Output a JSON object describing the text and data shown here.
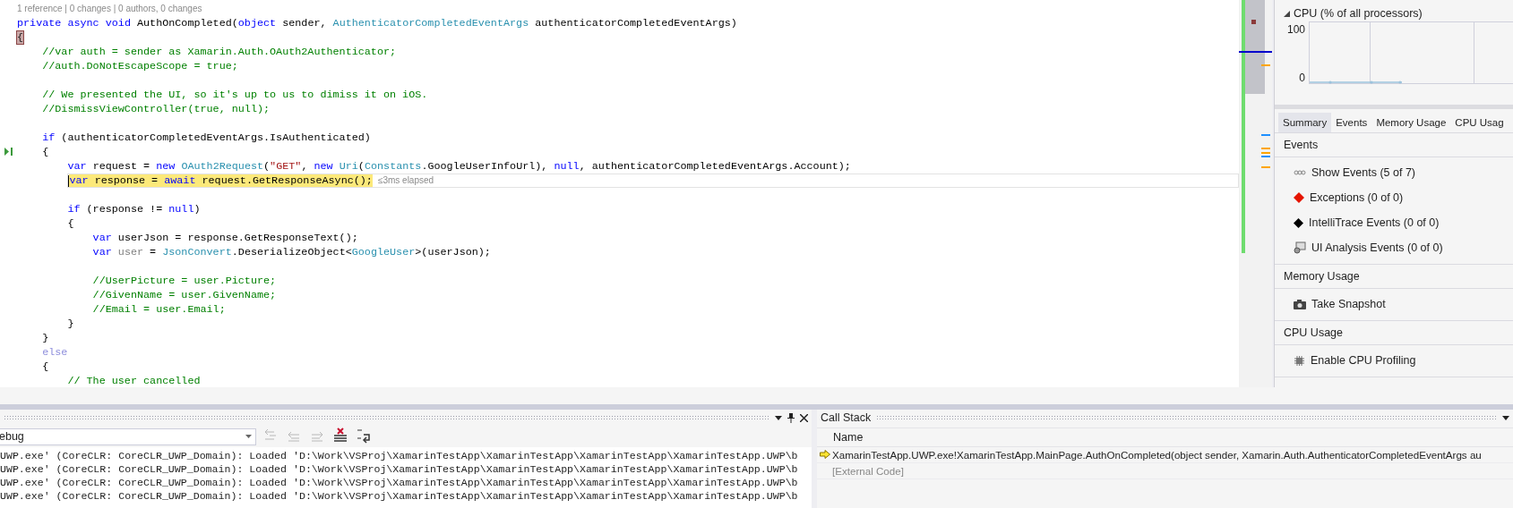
{
  "editor": {
    "code_lens": "1 reference | 0 changes | 0 authors, 0 changes",
    "lines": [
      {
        "current": false,
        "segments": [
          {
            "kind": "keyword",
            "text": "private"
          },
          {
            "kind": "keyword",
            "text": " async"
          },
          {
            "kind": "keyword",
            "text": " void"
          },
          {
            "kind": "plain",
            "text": " AuthOnCompleted("
          },
          {
            "kind": "keyword",
            "text": "object"
          },
          {
            "kind": "plain",
            "text": " sender, "
          },
          {
            "kind": "type",
            "text": "AuthenticatorCompletedEventArgs"
          },
          {
            "kind": "plain",
            "text": " authenticatorCompletedEventArgs)"
          }
        ]
      },
      {
        "current": false,
        "segments": [
          {
            "kind": "brace_match",
            "text": "{"
          }
        ]
      },
      {
        "current": false,
        "segments": [
          {
            "kind": "comment",
            "text": "    //var auth = sender as Xamarin.Auth.OAuth2Authenticator;"
          }
        ]
      },
      {
        "current": false,
        "segments": [
          {
            "kind": "comment",
            "text": "    //auth.DoNotEscapeScope = true;"
          }
        ]
      },
      {
        "current": false
      },
      {
        "current": false,
        "segments": [
          {
            "kind": "comment",
            "text": "    // We presented the UI, so it's up to us to dimiss it on iOS."
          }
        ]
      },
      {
        "current": false,
        "segments": [
          {
            "kind": "comment",
            "text": "    //DismissViewController(true, null);"
          }
        ]
      },
      {
        "current": false
      },
      {
        "current": false,
        "segments": [
          {
            "kind": "keyword",
            "text": "    if"
          },
          {
            "kind": "plain",
            "text": " (authenticatorCompletedEventArgs.IsAuthenticated)"
          }
        ]
      },
      {
        "current": false,
        "kind": "run-to-click",
        "segments": [
          {
            "kind": "plain",
            "text": "    {"
          }
        ]
      },
      {
        "current": false,
        "segments": [
          {
            "kind": "keyword",
            "text": "        var"
          },
          {
            "kind": "plain",
            "text": " request = "
          },
          {
            "kind": "keyword",
            "text": "new "
          },
          {
            "kind": "type",
            "text": "OAuth2Request"
          },
          {
            "kind": "plain",
            "text": "("
          },
          {
            "kind": "string",
            "text": "\"GET\""
          },
          {
            "kind": "plain",
            "text": ", "
          },
          {
            "kind": "keyword",
            "text": "new "
          },
          {
            "kind": "type",
            "text": "Uri"
          },
          {
            "kind": "plain",
            "text": "("
          },
          {
            "kind": "type",
            "text": "Constants"
          },
          {
            "kind": "plain",
            "text": ".GoogleUserInfoUrl), "
          },
          {
            "kind": "keyword",
            "text": "null"
          },
          {
            "kind": "plain",
            "text": ", authenticatorCompletedEventArgs.Account);"
          }
        ]
      },
      {
        "current": true,
        "segments": [
          {
            "kind": "keyword",
            "text": "        var"
          },
          {
            "kind": "plain",
            "text": " response = "
          },
          {
            "kind": "keyword",
            "text": "await"
          },
          {
            "kind": "plain",
            "text": " request.GetResponseAsync();"
          }
        ],
        "perf_tip": "≤3ms elapsed"
      },
      {
        "current": false
      },
      {
        "current": false,
        "segments": [
          {
            "kind": "keyword",
            "text": "        if"
          },
          {
            "kind": "plain",
            "text": " (response != "
          },
          {
            "kind": "keyword",
            "text": "null"
          },
          {
            "kind": "plain",
            "text": ")"
          }
        ]
      },
      {
        "current": false,
        "segments": [
          {
            "kind": "plain",
            "text": "        {"
          }
        ]
      },
      {
        "current": false,
        "segments": [
          {
            "kind": "keyword",
            "text": "            var"
          },
          {
            "kind": "plain",
            "text": " userJson = response.GetResponseText();"
          }
        ]
      },
      {
        "current": false,
        "segments": [
          {
            "kind": "keyword",
            "text": "            var"
          },
          {
            "kind": "unused",
            "text": " user"
          },
          {
            "kind": "plain",
            "text": " = "
          },
          {
            "kind": "type",
            "text": "JsonConvert"
          },
          {
            "kind": "plain",
            "text": ".DeserializeObject<"
          },
          {
            "kind": "type",
            "text": "GoogleUser"
          },
          {
            "kind": "plain",
            "text": ">(userJson);"
          }
        ]
      },
      {
        "current": false
      },
      {
        "current": false,
        "segments": [
          {
            "kind": "comment",
            "text": "            //UserPicture = user.Picture;"
          }
        ]
      },
      {
        "current": false,
        "segments": [
          {
            "kind": "comment",
            "text": "            //GivenName = user.GivenName;"
          }
        ]
      },
      {
        "current": false,
        "segments": [
          {
            "kind": "comment",
            "text": "            //Email = user.Email;"
          }
        ]
      },
      {
        "current": false,
        "segments": [
          {
            "kind": "plain",
            "text": "        }"
          }
        ]
      },
      {
        "current": false,
        "segments": [
          {
            "kind": "plain",
            "text": "    }"
          }
        ]
      },
      {
        "current": false,
        "segments": [
          {
            "kind": "inactive",
            "text": "    else"
          }
        ]
      },
      {
        "current": false,
        "segments": [
          {
            "kind": "plain",
            "text": "    {"
          }
        ]
      },
      {
        "current": false,
        "segments": [
          {
            "kind": "comment",
            "text": "        // The user cancelled"
          }
        ]
      }
    ]
  },
  "diagnostics": {
    "graph_title": "CPU (% of all processors)",
    "graph_axis_labels": [
      "100",
      "0"
    ],
    "tabs": [
      {
        "label": "Summary",
        "selected": true
      },
      {
        "label": "Events",
        "selected": false
      },
      {
        "label": "Memory Usage",
        "selected": false
      },
      {
        "label": "CPU Usag",
        "selected": false
      }
    ],
    "sections": [
      {
        "title": "Events",
        "items": [
          {
            "kind": "events",
            "label": "Show Events (5 of 7)"
          },
          {
            "kind": "exceptions",
            "label": "Exceptions (0 of 0)"
          },
          {
            "kind": "intellitrace",
            "label": "IntelliTrace Events (0 of 0)"
          },
          {
            "kind": "ui-analysis",
            "label": "UI Analysis Events (0 of 0)"
          }
        ]
      },
      {
        "title": "Memory Usage",
        "items": [
          {
            "kind": "snapshot",
            "label": "Take Snapshot"
          }
        ]
      },
      {
        "title": "CPU Usage",
        "items": [
          {
            "kind": "cpu",
            "label": "Enable CPU Profiling"
          }
        ]
      }
    ]
  },
  "output": {
    "source": "ebug",
    "toolbar": [
      {
        "kind": "find-source",
        "disabled": true
      },
      {
        "kind": "previous",
        "disabled": true
      },
      {
        "kind": "next",
        "disabled": true
      },
      {
        "kind": "clear-all",
        "disabled": false
      },
      {
        "kind": "word-wrap",
        "disabled": false
      }
    ],
    "lines": [
      "UWP.exe' (CoreCLR: CoreCLR_UWP_Domain): Loaded 'D:\\Work\\VSProj\\XamarinTestApp\\XamarinTestApp\\XamarinTestApp\\XamarinTestApp.UWP\\b",
      "UWP.exe' (CoreCLR: CoreCLR_UWP_Domain): Loaded 'D:\\Work\\VSProj\\XamarinTestApp\\XamarinTestApp\\XamarinTestApp\\XamarinTestApp.UWP\\b",
      "UWP.exe' (CoreCLR: CoreCLR_UWP_Domain): Loaded 'D:\\Work\\VSProj\\XamarinTestApp\\XamarinTestApp\\XamarinTestApp\\XamarinTestApp.UWP\\b",
      "UWP.exe' (CoreCLR: CoreCLR_UWP_Domain): Loaded 'D:\\Work\\VSProj\\XamarinTestApp\\XamarinTestApp\\XamarinTestApp\\XamarinTestApp.UWP\\b"
    ]
  },
  "call_stack": {
    "title": "Call Stack",
    "column": "Name",
    "frames": [
      {
        "kind": "frame",
        "current": true,
        "text": "XamarinTestApp.UWP.exe!XamarinTestApp.MainPage.AuthOnCompleted(object sender, Xamarin.Auth.AuthenticatorCompletedEventArgs au"
      },
      {
        "kind": "external",
        "current": false,
        "text": "[External Code]"
      }
    ]
  }
}
